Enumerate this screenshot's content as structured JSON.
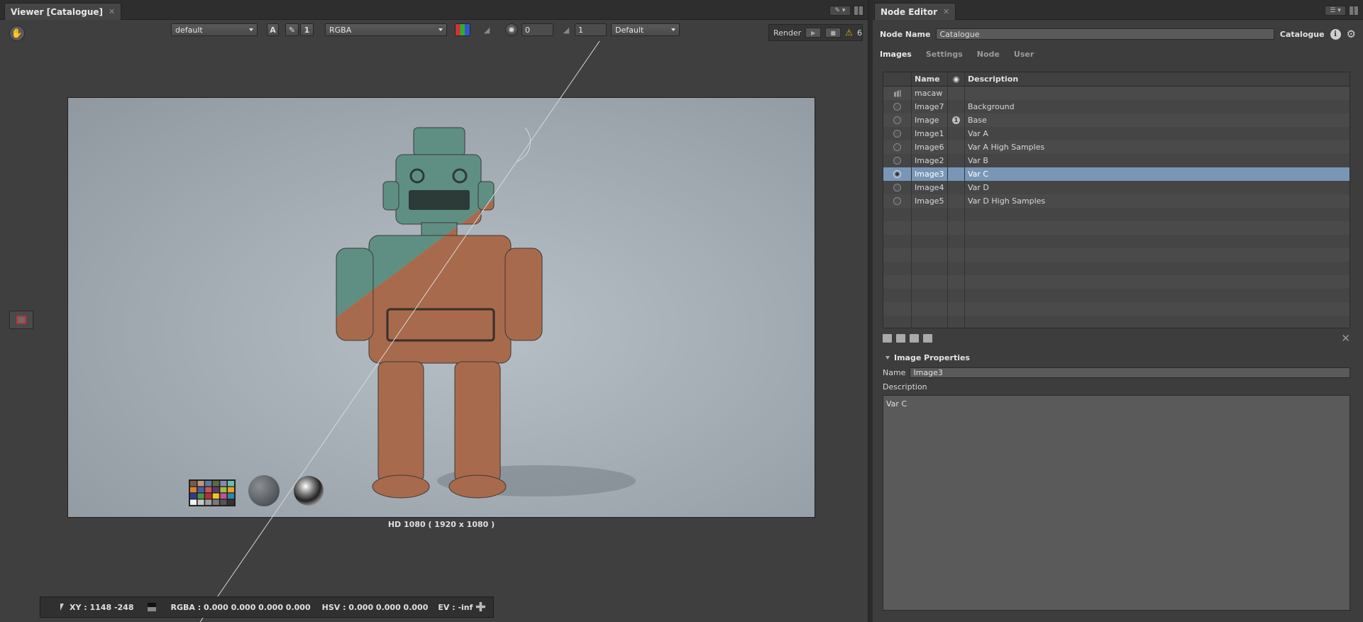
{
  "viewer": {
    "tab_title": "Viewer [Catalogue]",
    "toolbar": {
      "lut": "default",
      "btn_a": "A",
      "btn_1": "1",
      "channels": "RGBA",
      "exposure": "0",
      "gamma": "1",
      "display": "Default",
      "render_label": "Render",
      "warning_count": "6"
    },
    "resolution_label": "HD 1080 ( 1920 x 1080 )",
    "status": {
      "xy": "XY : 1148 -248",
      "rgba": "RGBA : 0.000 0.000 0.000 0.000",
      "hsv": "HSV : 0.000 0.000 0.000",
      "ev": "EV : -inf"
    }
  },
  "editor": {
    "tab_title": "Node Editor",
    "node_name_label": "Node Name",
    "node_name_value": "Catalogue",
    "node_type": "Catalogue",
    "tabs": [
      "Images",
      "Settings",
      "Node",
      "User"
    ],
    "table": {
      "headers": {
        "name": "Name",
        "description": "Description"
      },
      "rows": [
        {
          "name": "macaw",
          "description": "",
          "kind": "group"
        },
        {
          "name": "Image7",
          "description": "Background"
        },
        {
          "name": "Image",
          "description": "Base",
          "master": "1"
        },
        {
          "name": "Image1",
          "description": "Var A"
        },
        {
          "name": "Image6",
          "description": "Var A High Samples"
        },
        {
          "name": "Image2",
          "description": "Var B"
        },
        {
          "name": "Image3",
          "description": "Var C",
          "selected": true
        },
        {
          "name": "Image4",
          "description": "Var D"
        },
        {
          "name": "Image5",
          "description": "Var D High Samples"
        }
      ]
    },
    "properties": {
      "header": "Image Properties",
      "name_label": "Name",
      "name_value": "Image3",
      "description_label": "Description",
      "description_value": "Var C"
    }
  },
  "colors": {
    "selection": "#7a96b6",
    "warning": "#e3b21d",
    "robot_teal": "#5f8f83",
    "robot_copper": "#a86a4c"
  }
}
